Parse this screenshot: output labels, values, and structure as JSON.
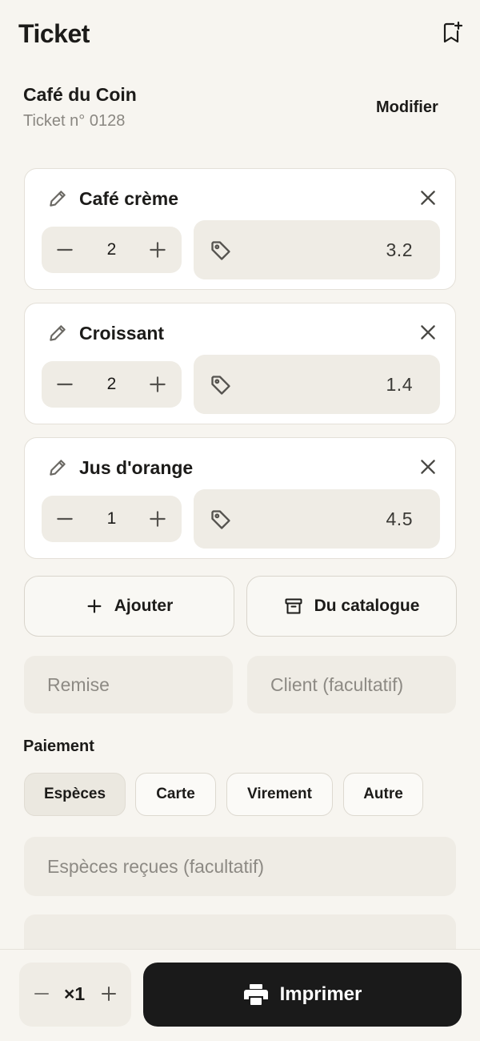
{
  "header": {
    "title": "Ticket",
    "bookmark_icon": "bookmark-add-icon"
  },
  "store": {
    "name": "Café du Coin",
    "ticket_number": "Ticket n° 0128",
    "edit_label": "Modifier"
  },
  "items": [
    {
      "name": "Café crème",
      "quantity": "2",
      "price": "3.2"
    },
    {
      "name": "Croissant",
      "quantity": "2",
      "price": "1.4"
    },
    {
      "name": "Jus d'orange",
      "quantity": "1",
      "price": "4.5"
    }
  ],
  "actions": {
    "add_label": "Ajouter",
    "catalog_label": "Du catalogue"
  },
  "fields": {
    "discount_placeholder": "Remise",
    "client_placeholder": "Client (facultatif)",
    "cash_received_placeholder": "Espèces reçues (facultatif)"
  },
  "payment": {
    "label": "Paiement",
    "methods": [
      "Espèces",
      "Carte",
      "Virement",
      "Autre"
    ],
    "selected": "Espèces"
  },
  "footer": {
    "copies": "×1",
    "print_label": "Imprimer"
  },
  "colors": {
    "accent": "#1a1a1a",
    "background": "#f7f5f0",
    "field": "#efece5"
  }
}
